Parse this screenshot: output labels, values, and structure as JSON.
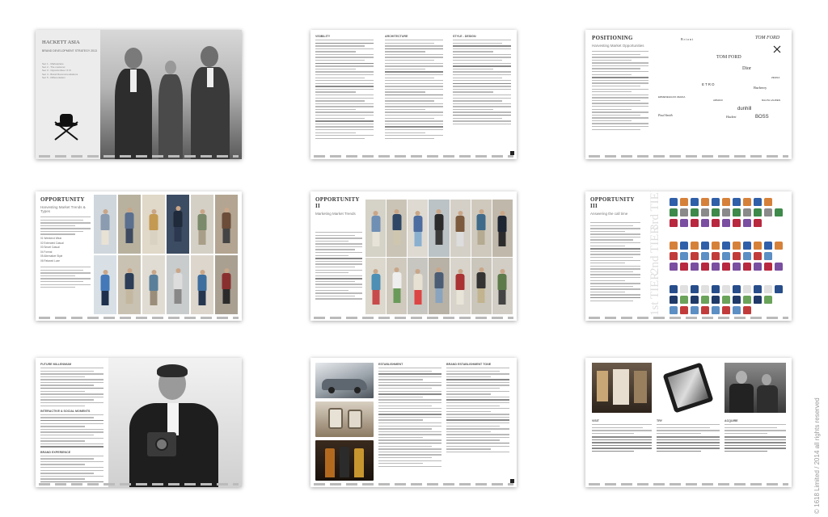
{
  "pages": [
    {
      "title": "HACKETT ASIA",
      "subtitle": "BRAND DEVELOPMENT STRATEGY 2013",
      "toc": [
        "Sec 1 - Marketplace",
        "Sec 2 - The customer",
        "Sec 3 - Opportunities I II III",
        "Sec 4 - Brand Recommendations",
        "Sec 5 - Differentiation"
      ]
    },
    {
      "headers": [
        "VISIBILITY",
        "ARCHITECTURE",
        "STYLE - DESIGN"
      ]
    },
    {
      "title": "POSITIONING",
      "subtitle": "Harvesting Market Opportunities",
      "brands": [
        "TOM FORD",
        "Dior",
        "Brioni",
        "ZEGNA",
        "Burberry",
        "ERMENEGILDO ZEGNA",
        "dunhill",
        "BOSS",
        "Paul Smith",
        "RALPH LAUREN",
        "ETRO",
        "ARMANI",
        "Hackett"
      ]
    },
    {
      "title": "OPPORTUNITY",
      "subtitle": "Harvesting Market Trends & Types",
      "list": [
        "01 Weekend Wear",
        "02 Extended Casual",
        "03 Smart Casual",
        "04 Formal",
        "05 Alternative Style",
        "06 Relaxed Luxe"
      ]
    },
    {
      "title": "OPPORTUNITY II",
      "subtitle": "Marketing Market Trends"
    },
    {
      "title": "OPPORTUNITY III",
      "subtitle": "Answering the call time",
      "tiers": [
        "3rd TIER",
        "2nd TIER",
        "1st TIER"
      ]
    },
    {
      "headers": [
        "FUTURE MILLENNIUM",
        "INTERACTIVE & SOCIAL MOMENTS",
        "BRAND EXPERIENCE"
      ]
    },
    {
      "headers": [
        "ESTABLISHMENT",
        "BRAND ESTABLISHMENT TONE"
      ]
    },
    {
      "headers": [
        "VISIT",
        "TRY",
        "ACQUIRE"
      ]
    }
  ],
  "credit": "© 1618 Limited / 2014 all rights reserved"
}
